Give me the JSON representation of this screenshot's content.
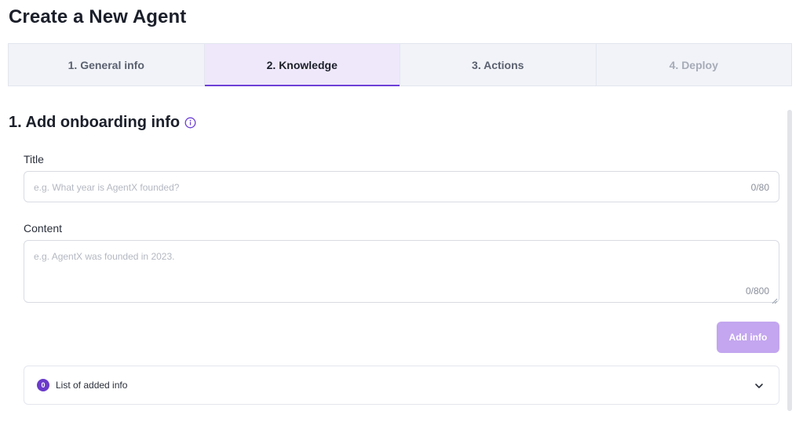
{
  "page": {
    "title": "Create a New Agent"
  },
  "tabs": [
    {
      "label": "1. General info",
      "state": "default"
    },
    {
      "label": "2. Knowledge",
      "state": "active"
    },
    {
      "label": "3. Actions",
      "state": "default"
    },
    {
      "label": "4. Deploy",
      "state": "disabled"
    }
  ],
  "section": {
    "title": "1. Add onboarding info",
    "icon": "info-circle-icon"
  },
  "title_field": {
    "label": "Title",
    "value": "",
    "placeholder": "e.g. What year is AgentX founded?",
    "counter": "0/80"
  },
  "content_field": {
    "label": "Content",
    "value": "",
    "placeholder": "e.g. AgentX was founded in 2023.",
    "counter": "0/800"
  },
  "add_button": {
    "label": "Add info",
    "enabled": false
  },
  "added_list": {
    "count": "0",
    "label": "List of added info",
    "icon": "chevron-down-icon"
  },
  "colors": {
    "accent": "#6d3fd6",
    "badge": "#6a3bc9",
    "active_tab_bg": "#efe8fb",
    "button_disabled": "#c3a6ef"
  }
}
